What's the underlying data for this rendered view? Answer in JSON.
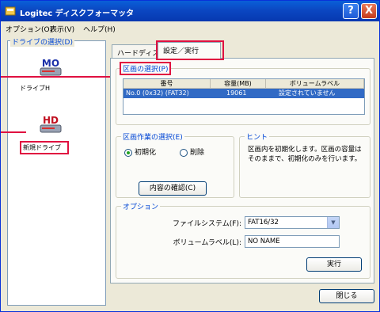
{
  "window": {
    "title": "Logitec ディスクフォーマッタ",
    "help_button": "?",
    "close_button": "X"
  },
  "menu": {
    "items": [
      "オプション(O)",
      "表示(V)",
      "ヘルプ(H)"
    ]
  },
  "sidebar": {
    "caption": "ドライブの選択(D)",
    "drives": [
      {
        "icon_text": "MO",
        "label": "ドライブH",
        "icon": "mo-drive-icon"
      },
      {
        "icon_text": "HD",
        "label": "新規ドライブ",
        "icon": "hd-drive-icon"
      }
    ]
  },
  "tabs": {
    "items": [
      "ハードディスク",
      "設定／実行"
    ],
    "active": "設定／実行"
  },
  "partition": {
    "caption": "区画の選択(P)",
    "columns": [
      "番号",
      "容量(MB)",
      "ボリュームラベル"
    ],
    "rows": [
      {
        "number": "No.0 (0x32) (FAT32)",
        "capacity": "19061",
        "label": "設定されていません"
      }
    ]
  },
  "operation": {
    "caption": "区画作業の選択(E)",
    "options": [
      "初期化",
      "削除"
    ],
    "selected": "初期化",
    "content_button": "内容の確認(C)"
  },
  "hint": {
    "caption": "ヒント",
    "text": "区画内を初期化します。区画の容量はそのままで、初期化のみを行います。"
  },
  "options": {
    "caption": "オプション",
    "filesystem_label": "ファイルシステム(F):",
    "filesystem_value": "FAT16/32",
    "volume_label_label": "ボリュームラベル(L):",
    "volume_label_value": "NO NAME",
    "execute_button": "実行"
  },
  "footer": {
    "close_button": "閉じる"
  },
  "colors": {
    "title_bar": "#0b47c2",
    "highlight": "#e01040",
    "selection": "#316ac5"
  }
}
